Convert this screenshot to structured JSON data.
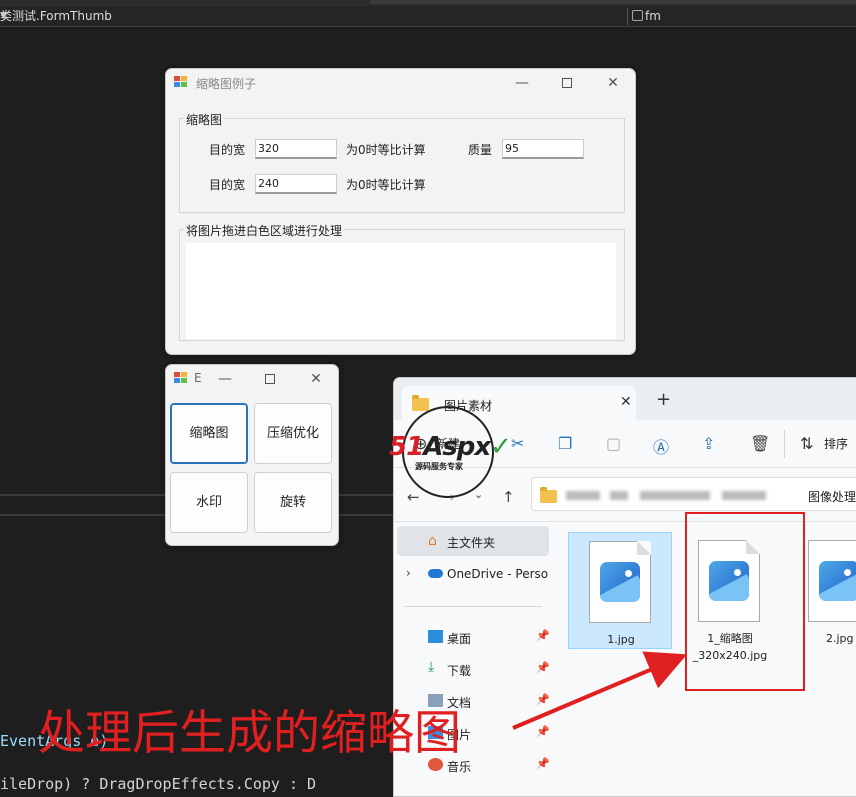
{
  "ide": {
    "nav_left": "类测试.FormThumb",
    "nav_right": "fm",
    "code_line_1": "EventArgs e)",
    "code_line_2": "ileDrop) ? DragDropEffects.Copy : D"
  },
  "thumb_window": {
    "title": "缩略图例子",
    "group_thumb": {
      "label": "缩略图",
      "width_label": "目的宽",
      "width_value": "320",
      "width_hint": "为0时等比计算",
      "quality_label": "质量",
      "quality_value": "95",
      "height_label": "目的宽",
      "height_value": "240",
      "height_hint": "为0时等比计算"
    },
    "group_drop": {
      "label": "将图片拖进白色区域进行处理"
    }
  },
  "menu_window": {
    "title": "Ε",
    "buttons": [
      "缩略图",
      "压缩优化",
      "水印",
      "旋转"
    ]
  },
  "explorer": {
    "tab_title": "图片素材",
    "toolbar": {
      "new_label": "新建",
      "sort_label": "排序"
    },
    "breadcrumb_last": "图像处理",
    "nav": {
      "home": "主文件夹",
      "onedrive": "OneDrive - Perso",
      "desktop": "桌面",
      "downloads": "下载",
      "documents": "文档",
      "pictures": "图片",
      "music": "音乐"
    },
    "files": [
      {
        "name": "1.jpg"
      },
      {
        "name": "1_缩略图_320x240.jpg"
      },
      {
        "name": "2.jpg"
      }
    ]
  },
  "watermark": {
    "main_red": "51",
    "main_black": "Aspx",
    "main_green": "✓",
    "sub": "源码服务专家"
  },
  "annotation": {
    "text": "处理后生成的缩略图",
    "color": "#e02020"
  }
}
